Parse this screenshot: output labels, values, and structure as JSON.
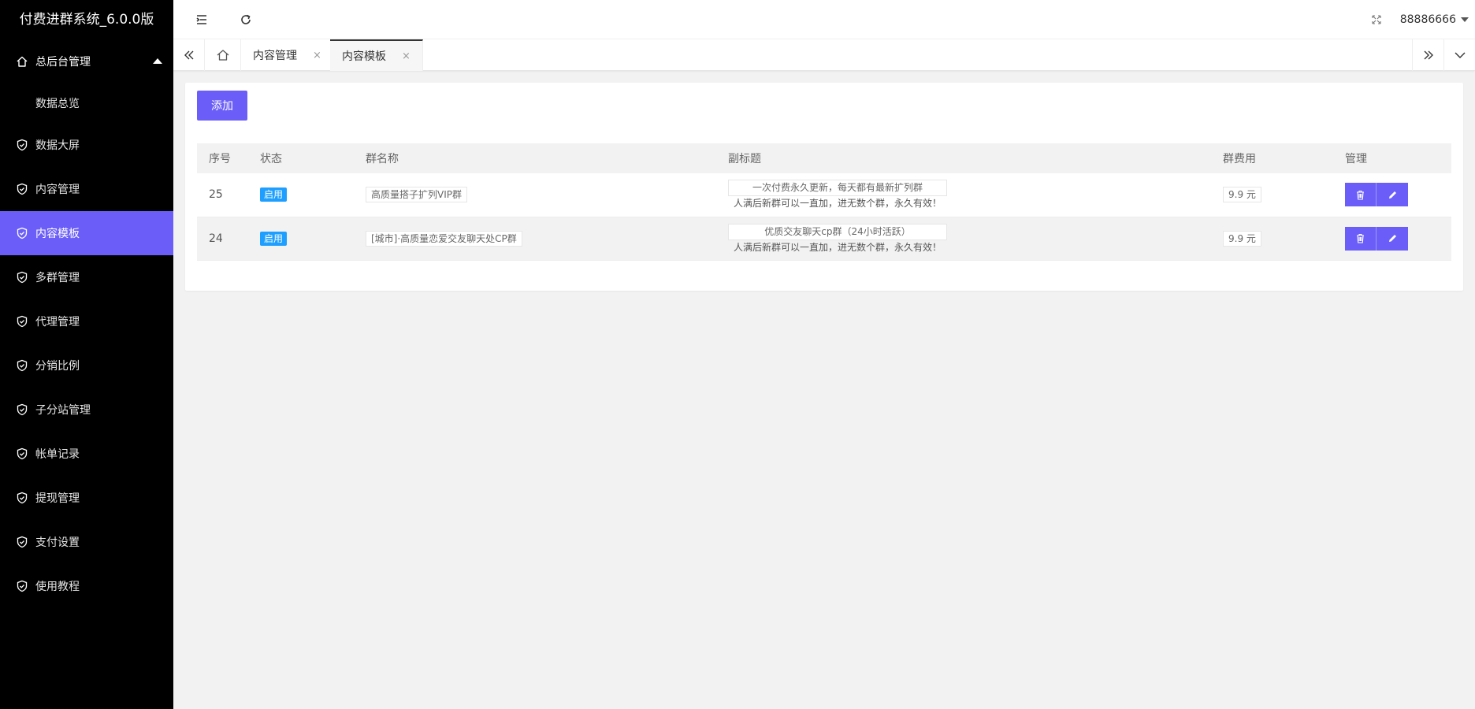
{
  "app": {
    "title": "付费进群系统_6.0.0版"
  },
  "sidebar": {
    "parent": {
      "label": "总后台管理"
    },
    "sub": {
      "label": "数据总览"
    },
    "items": [
      {
        "label": "数据大屏"
      },
      {
        "label": "内容管理"
      },
      {
        "label": "内容模板"
      },
      {
        "label": "多群管理"
      },
      {
        "label": "代理管理"
      },
      {
        "label": "分销比例"
      },
      {
        "label": "子分站管理"
      },
      {
        "label": "帐单记录"
      },
      {
        "label": "提现管理"
      },
      {
        "label": "支付设置"
      },
      {
        "label": "使用教程"
      }
    ],
    "active_index": 2
  },
  "header": {
    "user": "88886666"
  },
  "tabs": [
    {
      "label": "内容管理",
      "close": "×"
    },
    {
      "label": "内容模板",
      "close": "×"
    }
  ],
  "toolbar": {
    "add_label": "添加"
  },
  "table": {
    "headers": [
      "序号",
      "状态",
      "群名称",
      "副标题",
      "群费用",
      "管理"
    ],
    "rows": [
      {
        "id": "25",
        "status": "启用",
        "name": "高质量搭子扩列VIP群",
        "subtitle_1": "一次付费永久更新，每天都有最新扩列群",
        "subtitle_2": "人满后新群可以一直加，进无数个群，永久有效！",
        "fee": "9.9 元"
      },
      {
        "id": "24",
        "status": "启用",
        "name": "[城市]·高质量恋爱交友聊天处CP群",
        "subtitle_1": "优质交友聊天cp群（24小时活跃）",
        "subtitle_2": "人满后新群可以一直加，进无数个群，永久有效！",
        "fee": "9.9 元"
      }
    ]
  },
  "colors": {
    "accent": "#6b5ef8",
    "badge": "#1e9fff",
    "sidebar_bg": "#000000"
  }
}
